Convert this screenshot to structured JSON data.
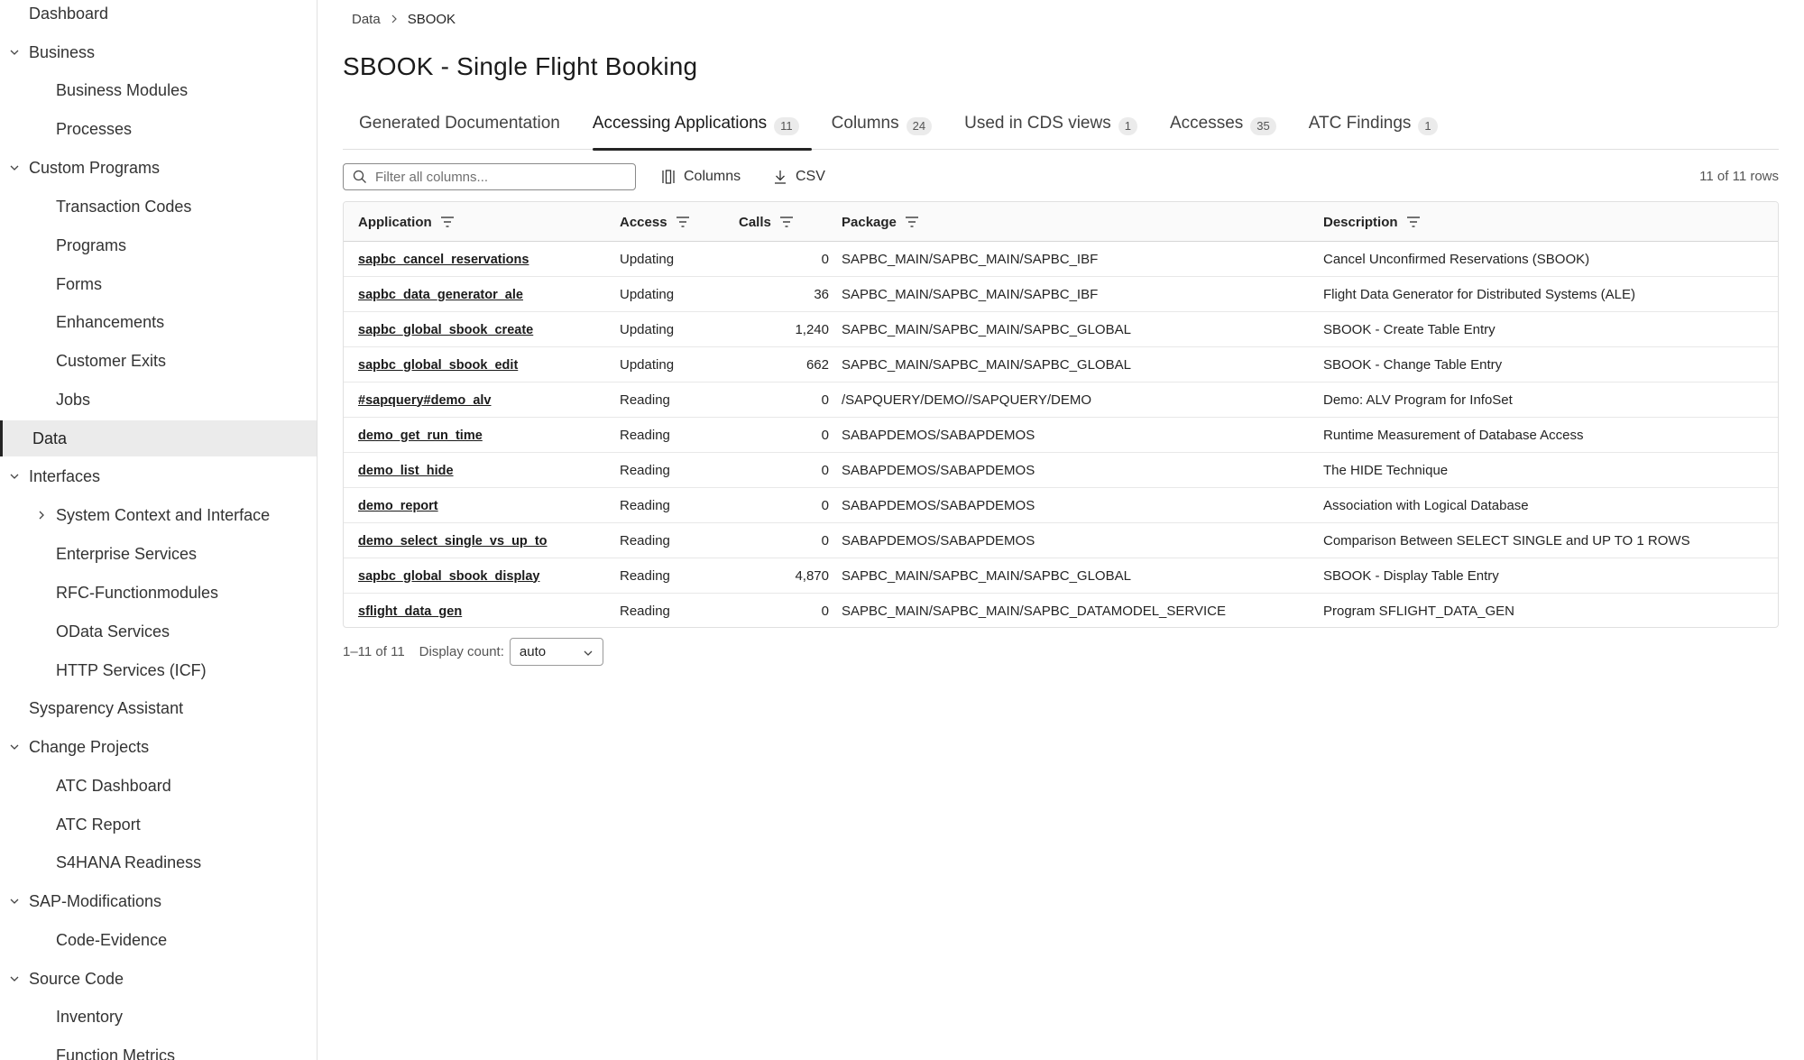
{
  "sidebar": {
    "items": [
      {
        "label": "Dashboard"
      },
      {
        "label": "Business"
      },
      {
        "label": "Business Modules"
      },
      {
        "label": "Processes"
      },
      {
        "label": "Custom Programs"
      },
      {
        "label": "Transaction Codes"
      },
      {
        "label": "Programs"
      },
      {
        "label": "Forms"
      },
      {
        "label": "Enhancements"
      },
      {
        "label": "Customer Exits"
      },
      {
        "label": "Jobs"
      },
      {
        "label": "Data"
      },
      {
        "label": "Interfaces"
      },
      {
        "label": "System Context and Interface"
      },
      {
        "label": "Enterprise Services"
      },
      {
        "label": "RFC-Functionmodules"
      },
      {
        "label": "OData Services"
      },
      {
        "label": "HTTP Services (ICF)"
      },
      {
        "label": "Sysparency Assistant"
      },
      {
        "label": "Change Projects"
      },
      {
        "label": "ATC Dashboard"
      },
      {
        "label": "ATC Report"
      },
      {
        "label": "S4HANA Readiness"
      },
      {
        "label": "SAP-Modifications"
      },
      {
        "label": "Code-Evidence"
      },
      {
        "label": "Source Code"
      },
      {
        "label": "Inventory"
      },
      {
        "label": "Function Metrics"
      }
    ]
  },
  "breadcrumb": {
    "parent": "Data",
    "current": "SBOOK"
  },
  "page": {
    "title": "SBOOK - Single Flight Booking"
  },
  "tabs": [
    {
      "label": "Generated Documentation",
      "count": ""
    },
    {
      "label": "Accessing Applications",
      "count": "11"
    },
    {
      "label": "Columns",
      "count": "24"
    },
    {
      "label": "Used in CDS views",
      "count": "1"
    },
    {
      "label": "Accesses",
      "count": "35"
    },
    {
      "label": "ATC Findings",
      "count": "1"
    }
  ],
  "toolbar": {
    "filter_placeholder": "Filter all columns...",
    "columns_label": "Columns",
    "csv_label": "CSV",
    "row_count": "11 of 11 rows"
  },
  "table": {
    "headers": [
      "Application",
      "Access",
      "Calls",
      "Package",
      "Description"
    ],
    "rows": [
      [
        "sapbc_cancel_reservations",
        "Updating",
        "0",
        "SAPBC_MAIN/SAPBC_MAIN/SAPBC_IBF",
        "Cancel Unconfirmed Reservations (SBOOK)"
      ],
      [
        "sapbc_data_generator_ale",
        "Updating",
        "36",
        "SAPBC_MAIN/SAPBC_MAIN/SAPBC_IBF",
        "Flight Data Generator for Distributed Systems (ALE)"
      ],
      [
        "sapbc_global_sbook_create",
        "Updating",
        "1,240",
        "SAPBC_MAIN/SAPBC_MAIN/SAPBC_GLOBAL",
        "SBOOK - Create Table Entry"
      ],
      [
        "sapbc_global_sbook_edit",
        "Updating",
        "662",
        "SAPBC_MAIN/SAPBC_MAIN/SAPBC_GLOBAL",
        "SBOOK - Change Table Entry"
      ],
      [
        "#sapquery#demo_alv",
        "Reading",
        "0",
        "/SAPQUERY/DEMO//SAPQUERY/DEMO",
        "Demo: ALV Program for InfoSet"
      ],
      [
        "demo_get_run_time",
        "Reading",
        "0",
        "SABAPDEMOS/SABAPDEMOS",
        "Runtime Measurement of Database Access"
      ],
      [
        "demo_list_hide",
        "Reading",
        "0",
        "SABAPDEMOS/SABAPDEMOS",
        "The HIDE Technique"
      ],
      [
        "demo_report",
        "Reading",
        "0",
        "SABAPDEMOS/SABAPDEMOS",
        "Association with Logical Database"
      ],
      [
        "demo_select_single_vs_up_to",
        "Reading",
        "0",
        "SABAPDEMOS/SABAPDEMOS",
        "Comparison Between SELECT SINGLE and UP TO 1 ROWS"
      ],
      [
        "sapbc_global_sbook_display",
        "Reading",
        "4,870",
        "SAPBC_MAIN/SAPBC_MAIN/SAPBC_GLOBAL",
        "SBOOK - Display Table Entry"
      ],
      [
        "sflight_data_gen",
        "Reading",
        "0",
        "SAPBC_MAIN/SAPBC_MAIN/SAPBC_DATAMODEL_SERVICE",
        "Program SFLIGHT_DATA_GEN"
      ]
    ]
  },
  "pager": {
    "range": "1–11 of 11",
    "display_count_label": "Display count:",
    "display_count_value": "auto"
  },
  "icons": {
    "chevron": "chevron-icon",
    "search": "search-icon",
    "columns": "columns-icon",
    "download": "download-icon",
    "filter": "filter-icon"
  }
}
